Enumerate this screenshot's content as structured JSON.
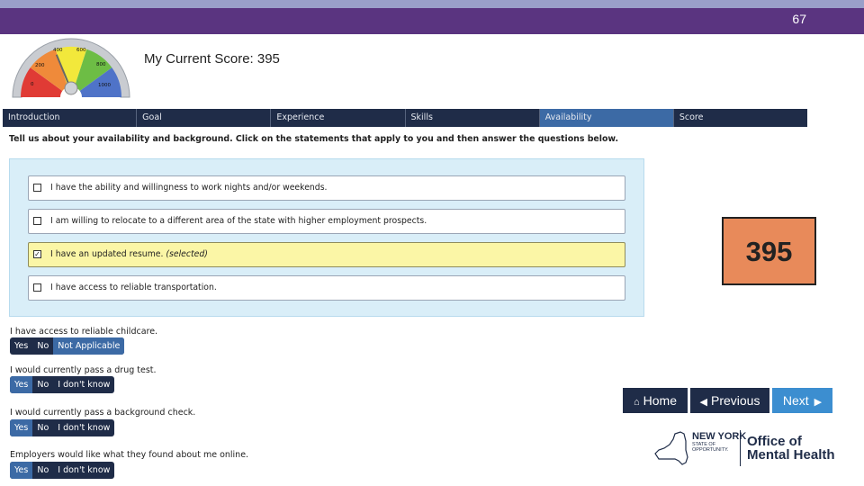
{
  "slide": {
    "page_number": "67"
  },
  "gauge": {
    "labels": [
      "0",
      "200",
      "400",
      "600",
      "800",
      "1000"
    ],
    "segment_colors": [
      "#e03b35",
      "#ef8a3a",
      "#f2e83b",
      "#6dbd45",
      "#4f73c8"
    ],
    "score": 395
  },
  "header": {
    "title": "My Current Score: 395"
  },
  "tabs": [
    {
      "label": "Introduction",
      "active": false
    },
    {
      "label": "Goal",
      "active": false
    },
    {
      "label": "Experience",
      "active": false
    },
    {
      "label": "Skills",
      "active": false
    },
    {
      "label": "Availability",
      "active": true
    },
    {
      "label": "Score",
      "active": false
    }
  ],
  "instructions": "Tell us about your availability and background. Click on the statements that apply to you and then answer the questions below.",
  "statements": [
    {
      "text": "I have the ability and willingness to work nights and/or weekends.",
      "selected": false
    },
    {
      "text": "I am willing to relocate to a different area of the state with higher employment prospects.",
      "selected": false
    },
    {
      "text": "I have an updated resume.",
      "selected_note": "(selected)",
      "selected": true
    },
    {
      "text": "I have access to reliable transportation.",
      "selected": false
    }
  ],
  "questions": [
    {
      "text": "I have access to reliable childcare.",
      "options": [
        "Yes",
        "No",
        "Not Applicable"
      ],
      "active_index": 2
    },
    {
      "text": "I would currently pass a drug test.",
      "options": [
        "Yes",
        "No",
        "I don't know"
      ],
      "active_index": 0
    },
    {
      "text": "I would currently pass a background check.",
      "options": [
        "Yes",
        "No",
        "I don't know"
      ],
      "active_index": 0
    },
    {
      "text": "Employers would like what they found about me online.",
      "options": [
        "Yes",
        "No",
        "I don't know"
      ],
      "active_index": 0
    }
  ],
  "score_box": {
    "value": "395",
    "color": "#e88a5a"
  },
  "nav": {
    "home": "Home",
    "previous": "Previous",
    "next": "Next"
  },
  "logo": {
    "state_title_line1": "NEW YORK",
    "state_sub_line1": "STATE OF",
    "state_sub_line2": "OPPORTUNITY.",
    "office_line1": "Office of",
    "office_line2": "Mental Health"
  }
}
